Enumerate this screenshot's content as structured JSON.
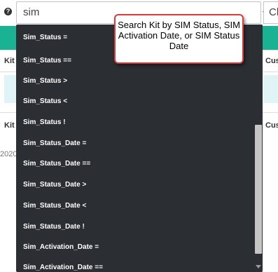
{
  "toolbar": {
    "help_glyph": "?",
    "search_value": "sim",
    "right_field_text": "Cl"
  },
  "background": {
    "header_left": "Kit",
    "header_right": "Cus",
    "row_left": "Kit",
    "row_right": "Cus",
    "date_fragment": "2020"
  },
  "dropdown": {
    "options": [
      "Sim_Status =",
      "Sim_Status ==",
      "Sim_Status >",
      "Sim_Status <",
      "Sim_Status !",
      "Sim_Status_Date =",
      "Sim_Status_Date ==",
      "Sim_Status_Date >",
      "Sim_Status_Date <",
      "Sim_Status_Date !",
      "Sim_Activation_Date =",
      "Sim_Activation_Date =="
    ]
  },
  "callout": {
    "text": "Search Kit by SIM Status, SIM Activation Date, or SIM Status Date"
  },
  "colors": {
    "accent_green": "#19b394",
    "dropdown_bg": "#2b2e33",
    "callout_border": "#d93a3a"
  }
}
